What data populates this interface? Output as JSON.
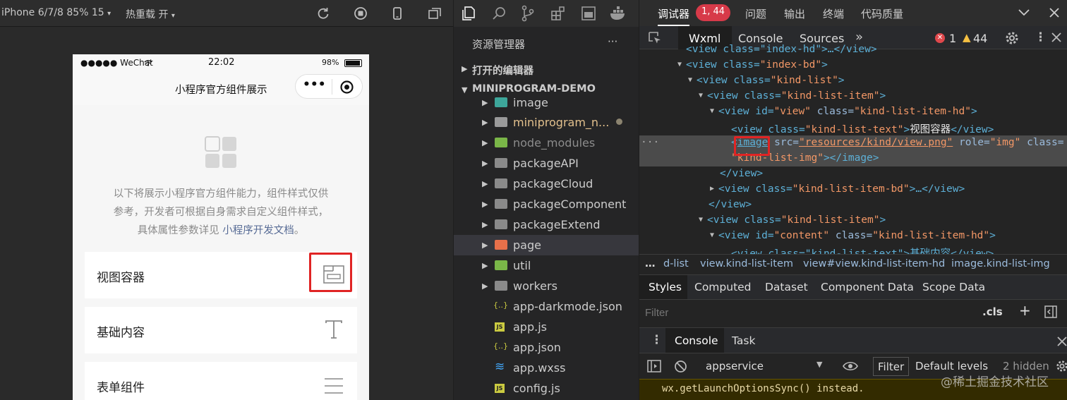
{
  "simulator": {
    "toolbar": {
      "device": "iPhone 6/7/8 85% 15",
      "hot_reload": "热重载 开"
    },
    "statusbar": {
      "carrier": "●●●●● WeChat",
      "time": "22:02",
      "battery": "98%"
    },
    "navbar": {
      "title": "小程序官方组件展示",
      "more": "•••"
    },
    "intro": {
      "line1": "以下将展示小程序官方组件能力，组件样式仅供",
      "line2": "参考，开发者可根据自身需求自定义组件样式，",
      "line3_prefix": "具体属性参数详见 ",
      "line3_link": "小程序开发文档",
      "line3_suffix": "。"
    },
    "cards": [
      {
        "label": "视图容器",
        "icon": "view-container-icon"
      },
      {
        "label": "基础内容",
        "icon": "text-icon"
      },
      {
        "label": "表单组件",
        "icon": "list-lines-icon"
      }
    ]
  },
  "explorer": {
    "title": "资源管理器",
    "more": "···",
    "open_editors": "打开的编辑器",
    "project": "MINIPROGRAM-DEMO",
    "items": [
      {
        "name": "image",
        "type": "folder",
        "color": "#3da69a"
      },
      {
        "name": "miniprogram_n...",
        "type": "folder",
        "color": "#9a9a9a",
        "modified": true
      },
      {
        "name": "node_modules",
        "type": "folder",
        "color": "#7ab648"
      },
      {
        "name": "packageAPI",
        "type": "folder",
        "color": "#8a8a8a"
      },
      {
        "name": "packageCloud",
        "type": "folder",
        "color": "#8a8a8a"
      },
      {
        "name": "packageComponent",
        "type": "folder",
        "color": "#8a8a8a"
      },
      {
        "name": "packageExtend",
        "type": "folder",
        "color": "#8a8a8a"
      },
      {
        "name": "page",
        "type": "folder",
        "color": "#e8704a"
      },
      {
        "name": "util",
        "type": "folder",
        "color": "#7ab648"
      },
      {
        "name": "workers",
        "type": "folder",
        "color": "#8a8a8a"
      },
      {
        "name": "app-darkmode.json",
        "type": "json",
        "glyph": "{..}"
      },
      {
        "name": "app.js",
        "type": "js",
        "glyph": "JS"
      },
      {
        "name": "app.json",
        "type": "json",
        "glyph": "{..}"
      },
      {
        "name": "app.wxss",
        "type": "css",
        "glyph": "≋"
      },
      {
        "name": "config.js",
        "type": "js",
        "glyph": "JS"
      }
    ]
  },
  "debugger": {
    "top": {
      "title": "调试器",
      "badge": "1, 44",
      "tabs": [
        "问题",
        "输出",
        "终端",
        "代码质量"
      ]
    },
    "devtools_tabs": [
      "Wxml",
      "Console",
      "Sources"
    ],
    "more_tabs": "»",
    "errors": "1",
    "warnings": "44",
    "dom": {
      "l0": "<view class=\"index-hd\">…</view>",
      "l1_tag": "<view class=",
      "l1_val": "\"index-bd\"",
      "l1_end": ">",
      "l2_tag": "<view class=",
      "l2_val": "\"kind-list\"",
      "l2_end": ">",
      "l3_tag": "<view class=",
      "l3_val": "\"kind-list-item\"",
      "l3_end": ">",
      "l4_tag": "<view id=",
      "l4_val1": "\"view\"",
      "l4_mid": " class=",
      "l4_val2": "\"kind-list-item-hd\"",
      "l4_end": ">",
      "l5_tag": "<view class=",
      "l5_val": "\"kind-list-text\"",
      "l5_mid": ">",
      "l5_text": "视图容器",
      "l5_end": "</view>",
      "l6_open": "<",
      "l6_name": "image",
      "l6_attr1": " src=",
      "l6_val1": "\"resources/kind/view.png\"",
      "l6_attr2": " role=",
      "l6_val2": "\"img\"",
      "l6_attr3": " class=",
      "l7_val": "\"kind-list-img\"",
      "l7_end": "></image>",
      "l8": "</view>",
      "l9_tag": "<view class=",
      "l9_val": "\"kind-list-item-bd\"",
      "l9_end": ">…</view>",
      "l10": "</view>",
      "l11_tag": "<view class=",
      "l11_val": "\"kind-list-item\"",
      "l11_end": ">",
      "l12_tag": "<view id=",
      "l12_val1": "\"content\"",
      "l12_mid": " class=",
      "l12_val2": "\"kind-list-item-hd\"",
      "l12_end": ">",
      "l13": "<view class=\"kind-list-text\">基础内容</view>",
      "ellipsis": "···"
    },
    "breadcrumbs": [
      "…",
      "d-list",
      "view.kind-list-item",
      "view#view.kind-list-item-hd",
      "image.kind-list-img"
    ],
    "style_tabs": [
      "Styles",
      "Computed",
      "Dataset",
      "Component Data",
      "Scope Data"
    ],
    "filter": {
      "placeholder": "Filter",
      "cls": ".cls",
      "plus": "+"
    },
    "console_tabs": [
      "Console",
      "Task"
    ],
    "console_tools": {
      "context": "appservice",
      "filter": "Filter",
      "levels": "Default levels",
      "hidden": "2 hidden"
    },
    "console_message": "wx.getLaunchOptionsSync() instead."
  },
  "watermark": "@稀土掘金技术社区",
  "colors": {
    "accent": "#e02424",
    "link": "#576b95",
    "badge": "#d73a49"
  }
}
